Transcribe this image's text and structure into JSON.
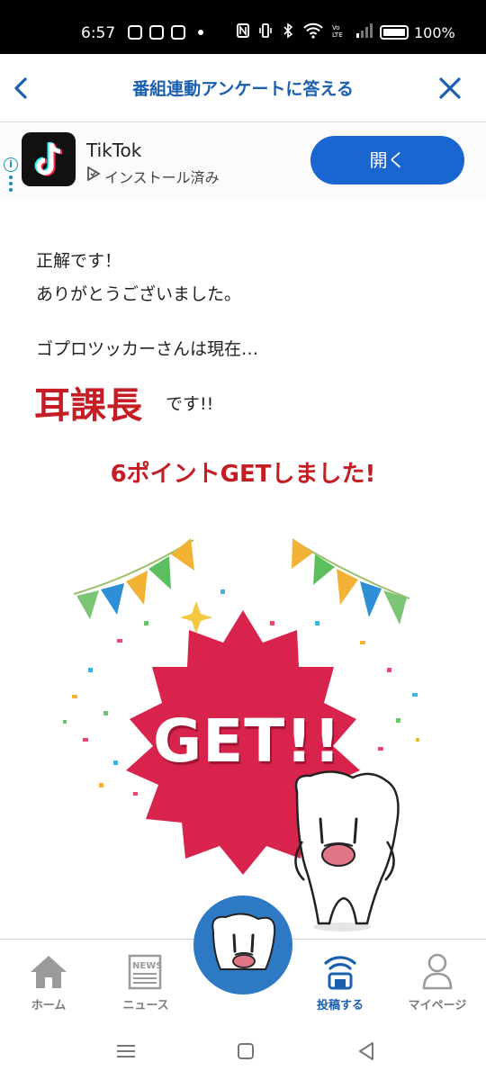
{
  "status_bar": {
    "time": "6:57",
    "battery": "100%"
  },
  "header": {
    "title": "番組連動アンケートに答える"
  },
  "ad": {
    "app_name": "TikTok",
    "status": "インストール済み",
    "open_button": "開く",
    "info_mark": "i"
  },
  "message": {
    "line1": "正解です！",
    "line2": "ありがとうございました。",
    "line3": "ゴプロツッカーさんは現在…",
    "rank": "耳課長",
    "rank_suffix": "です!!",
    "points": "6ポイントGETしました!",
    "badge_text": "GET!!"
  },
  "bottom_nav": {
    "items": [
      {
        "label": "ホーム",
        "icon": "home-icon"
      },
      {
        "label": "ニュース",
        "icon": "news-icon"
      },
      {
        "label": "",
        "icon": "mascot-icon"
      },
      {
        "label": "投稿する",
        "icon": "post-icon"
      },
      {
        "label": "マイページ",
        "icon": "person-icon"
      }
    ],
    "news_icon_text": "NEWS"
  },
  "colors": {
    "brand_blue": "#1a5fb0",
    "accent_red": "#c41d24",
    "badge_red": "#d8244d",
    "fab_blue": "#2d79c4",
    "ad_button_blue": "#1a66d0"
  }
}
